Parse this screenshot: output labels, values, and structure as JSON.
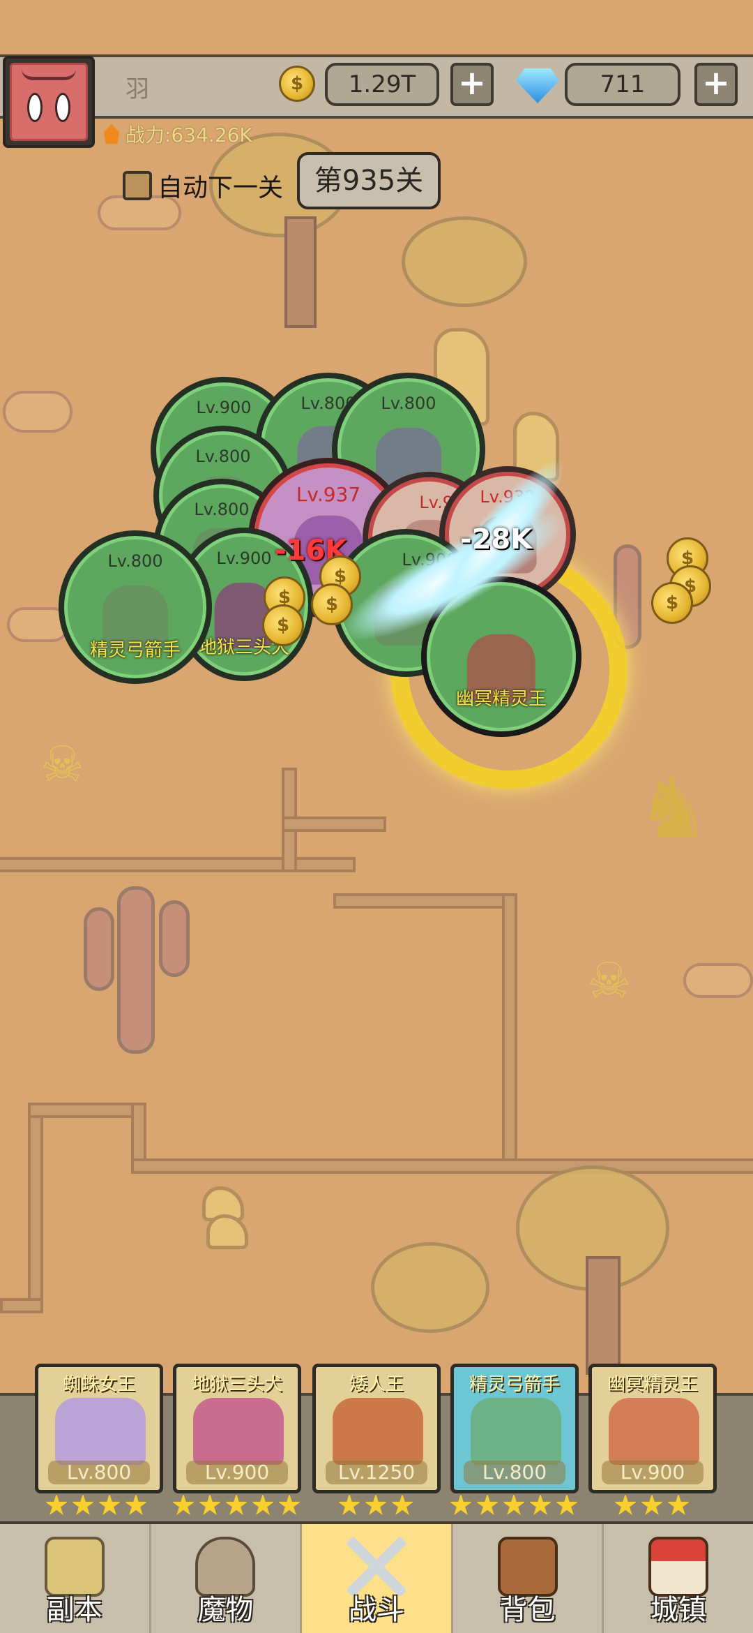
{
  "player": {
    "name": "羽",
    "power_label": "战力:634.26K",
    "gold": "1.29T",
    "gems": "711"
  },
  "stage": {
    "auto_next_label": "自动下一关",
    "current": "第935关"
  },
  "units": [
    {
      "level": "Lv.900",
      "side": "ally"
    },
    {
      "level": "Lv.800",
      "side": "ally"
    },
    {
      "level": "Lv.800",
      "side": "ally"
    },
    {
      "level": "Lv.800",
      "side": "ally"
    },
    {
      "level": "Lv.800",
      "side": "ally"
    },
    {
      "level": "Lv.900",
      "side": "ally"
    },
    {
      "level": "Lv.937",
      "side": "enemy"
    },
    {
      "level": "Lv.932",
      "side": "enemy"
    },
    {
      "level": "Lv.932",
      "side": "enemy"
    },
    {
      "level": "Lv.900",
      "side": "ally"
    },
    {
      "level": "Lv.800",
      "side": "ally",
      "name": "精灵弓箭手"
    },
    {
      "level": "Lv.900",
      "side": "ally",
      "name": "地狱三头犬"
    },
    {
      "side": "ally",
      "name": "幽冥精灵王"
    }
  ],
  "damage_numbers": [
    "-16K",
    "-28K"
  ],
  "heroes": [
    {
      "name": "蜘蛛女王",
      "level": "Lv.800",
      "stars": 4,
      "color": "#b59be0"
    },
    {
      "name": "地狱三头犬",
      "level": "Lv.900",
      "stars": 5,
      "color": "#c45a8e"
    },
    {
      "name": "矮人王",
      "level": "Lv.1250",
      "stars": 3,
      "color": "#c76a3a"
    },
    {
      "name": "精灵弓箭手",
      "level": "Lv.800",
      "stars": 5,
      "color": "#6fae7a"
    },
    {
      "name": "幽冥精灵王",
      "level": "Lv.900",
      "stars": 3,
      "color": "#d0704a"
    }
  ],
  "nav": [
    {
      "label": "副本",
      "icon": "map-scroll-icon",
      "active": false
    },
    {
      "label": "魔物",
      "icon": "horned-helmet-icon",
      "active": false
    },
    {
      "label": "战斗",
      "icon": "crossed-swords-icon",
      "active": true
    },
    {
      "label": "背包",
      "icon": "backpack-icon",
      "active": false
    },
    {
      "label": "城镇",
      "icon": "town-house-icon",
      "active": false
    }
  ],
  "colors": {
    "ally_fill": "#5ea75e",
    "enemy_ring": "#d54646",
    "gold_ring": "#f4d22a",
    "active_tab": "#ffe08a"
  }
}
